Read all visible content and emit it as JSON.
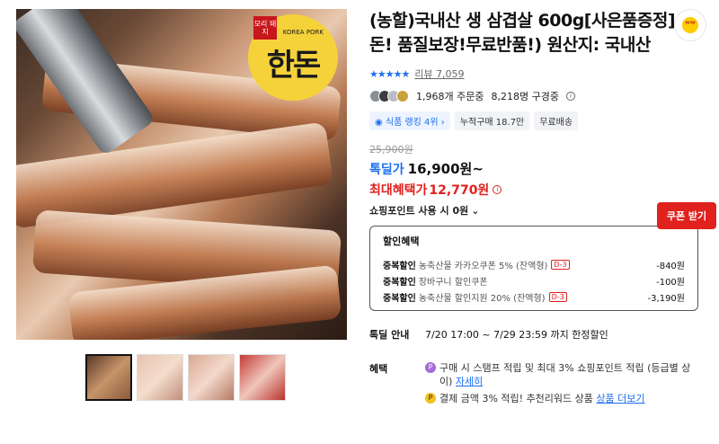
{
  "product": {
    "title": "(농할)국내산 생 삼겹살 600g[사은품증정](한돈! 품질보장!무료반품!) 원산지: 국내산",
    "logo_text": "한돈",
    "logo_seal": "모리 돼지",
    "logo_sub": "KOREA PORK",
    "stars": "★★★★★",
    "review_label": "리뷰",
    "review_count": "7,059",
    "orders": "1,968개 주문중",
    "purchases": "8,218명 구경중",
    "info_glyph": "i",
    "badges": [
      "◉ 식품 랭킹 4위 ›",
      "누적구매 18.7만",
      "무료배송"
    ],
    "original_price": "25,900원",
    "price_label": "톡딜가",
    "price_value": "16,900원~",
    "max_label": "최대혜택가",
    "max_value": "12,770원",
    "coupon_button": "쿠폰 받기",
    "points_text": "쇼핑포인트 사용 시 0원",
    "points_chevron": "⌄"
  },
  "discounts": {
    "title": "할인혜택",
    "rows": [
      {
        "type": "중복할인",
        "name": "농축산물 카카오쿠폰 5% (잔액형)",
        "tag": "D-3",
        "amount": "-840원"
      },
      {
        "type": "중복할인",
        "name": "장바구니 할인쿠폰",
        "tag": "",
        "amount": "-100원"
      },
      {
        "type": "중복할인",
        "name": "농축산물 할인지원 20% (잔액형)",
        "tag": "D-3",
        "amount": "-3,190원"
      }
    ]
  },
  "deal": {
    "label": "톡딜 안내",
    "text": "7/20 17:00 ~ 7/29 23:59 까지 한정할인"
  },
  "benefit": {
    "label": "혜택",
    "item1_icon": "P",
    "item1_text": "구매 시 스탬프 적립 및 최대 3% 쇼핑포인트 적립 (등급별 상이)",
    "item1_link": "자세히",
    "item2_icon": "P",
    "item2_text": "결제 금액 3% 적립! 추천리워드 상품",
    "item2_link": "상품 더보기"
  },
  "float_icon": "ʷʷ",
  "colors": {
    "accent_blue": "#1e6ff0",
    "accent_red": "#e0211d",
    "logo_yellow": "#f5d23a"
  }
}
